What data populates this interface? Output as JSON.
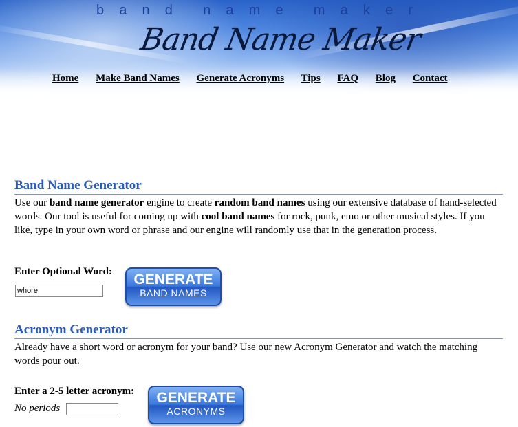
{
  "header": {
    "tagline_letters": [
      "b",
      "a",
      "n",
      "d",
      "",
      "n",
      "a",
      "m",
      "e",
      "",
      "m",
      "a",
      "k",
      "e",
      "r"
    ],
    "logo_text": "Band Name Maker",
    "nav": [
      "Home",
      "Make Band Names",
      "Generate Acronyms",
      "Tips",
      "FAQ",
      "Blog",
      "Contact"
    ]
  },
  "band_section": {
    "heading": "Band Name Generator",
    "intro_pre": "Use our ",
    "intro_bold1": "band name generator",
    "intro_mid1": " engine to create ",
    "intro_bold2": "random band names",
    "intro_mid2": " using our extensive database of hand-selected words. Our tool is useful for coming up with ",
    "intro_bold3": "cool band names",
    "intro_post": " for rock, punk, emo or other musical styles. If you like, type in your own word or phrase and our engine will randomly use that in the generation process.",
    "input_label": "Enter Optional Word:",
    "input_value": "whore",
    "button_big": "GENERATE",
    "button_small": "BAND NAMES"
  },
  "acronym_section": {
    "heading": "Acronym Generator",
    "intro": "Already have a short word or acronym for your band? Use our new Acronym Generator and watch the matching words pour out.",
    "input_label": "Enter a 2-5 letter acronym:",
    "hint": "No periods",
    "input_value": "",
    "button_big": "GENERATE",
    "button_small": "ACRONYMS"
  },
  "colors": {
    "heading": "#2c5cb8",
    "banner": "#4d86e0",
    "button": "#3a78dc"
  }
}
